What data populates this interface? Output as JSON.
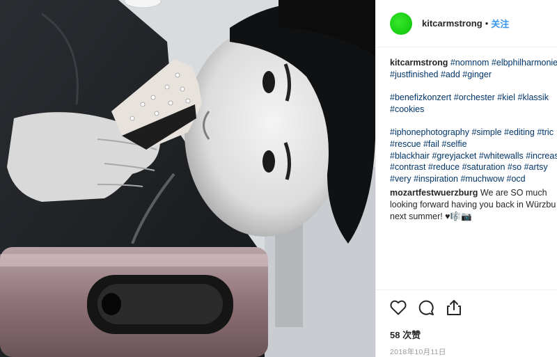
{
  "post": {
    "username": "kitcarmstrong",
    "separator": "•",
    "follow_label": "关注",
    "avatar_color": "#1bd114"
  },
  "caption": {
    "author": "kitcarmstrong",
    "line1_tags": [
      "#nomnom",
      "#elbphilharmonie"
    ],
    "line2_tags": [
      "#justfinished",
      "#add",
      "#ginger"
    ],
    "line3_tags": [
      "#benefizkonzert",
      "#orchester",
      "#kiel",
      "#klassik"
    ],
    "line4_tags": [
      "#cookies"
    ],
    "line5_tags": [
      "#iphonephotography",
      "#simple",
      "#editing",
      "#tric"
    ],
    "line6_tags": [
      "#rescue",
      "#fail",
      "#selfie"
    ],
    "line7_tags": [
      "#blackhair",
      "#greyjacket",
      "#whitewalls",
      "#increas"
    ],
    "line8_tags": [
      "#contrast",
      "#reduce",
      "#saturation",
      "#so",
      "#artsy"
    ],
    "line9_tags": [
      "#very",
      "#inspiration",
      "#muchwow",
      "#ocd"
    ]
  },
  "comment": {
    "author": "mozartfestwuerzburg",
    "line1": "We are SO much",
    "line2": "looking forward having you back in Würzbu",
    "line3": "next summer! ♥🎼📷"
  },
  "footer": {
    "likes": "58 次赞",
    "date": "2018年10月11日"
  },
  "icons": {
    "like": "heart-icon",
    "comment": "comment-icon",
    "share": "share-icon"
  },
  "colors": {
    "hashtag": "#003569",
    "follow": "#3897f0",
    "muted": "#999999",
    "text": "#262626"
  }
}
